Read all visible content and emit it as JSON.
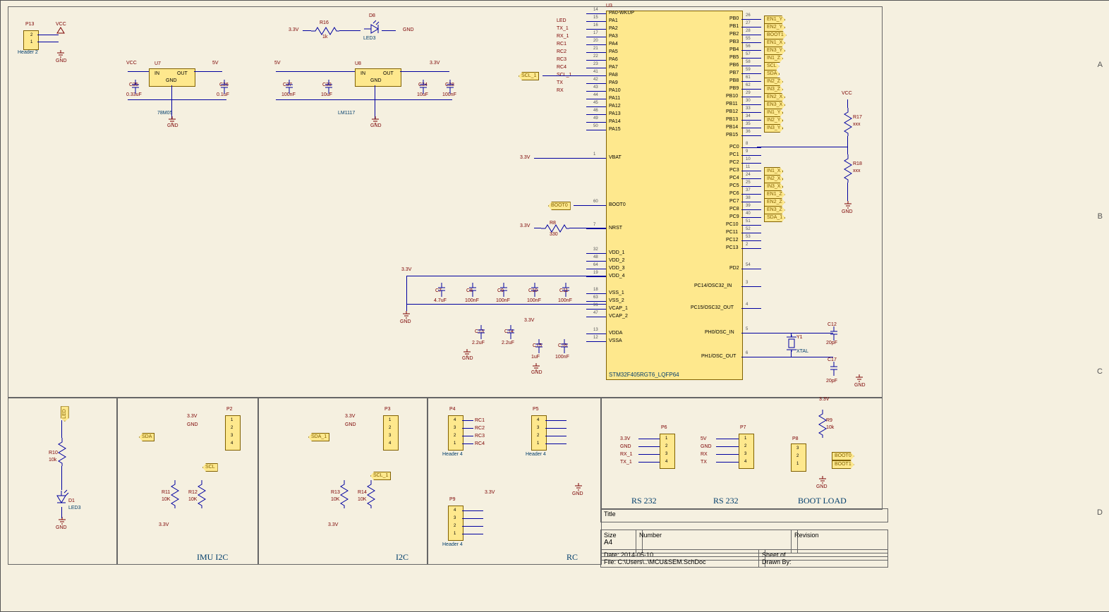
{
  "chart_data": {
    "type": "schematic",
    "title_block": {
      "title_label": "Title",
      "size_label": "Size",
      "size": "A4",
      "number_label": "Number",
      "revision_label": "Revision",
      "date_label": "Date:",
      "date": "2014-05-10",
      "sheet_label": "Sheet    of",
      "file_label": "File:",
      "file": "C:\\Users\\..\\MCU&SEM.SchDoc",
      "drawn_by_label": "Drawn By:"
    },
    "grid_rows": [
      "A",
      "B",
      "C",
      "D"
    ],
    "mcu": {
      "ref": "U3",
      "part": "STM32F405RGT6_LQFP64",
      "left_pins": [
        {
          "num": "14",
          "name": "PA0-WKUP",
          "net": ""
        },
        {
          "num": "15",
          "name": "PA1",
          "net": "LED"
        },
        {
          "num": "16",
          "name": "PA2",
          "net": "TX_1"
        },
        {
          "num": "17",
          "name": "PA3",
          "net": "RX_1"
        },
        {
          "num": "20",
          "name": "PA4",
          "net": "RC1"
        },
        {
          "num": "21",
          "name": "PA5",
          "net": "RC2"
        },
        {
          "num": "22",
          "name": "PA6",
          "net": "RC3"
        },
        {
          "num": "23",
          "name": "PA7",
          "net": "RC4"
        },
        {
          "num": "41",
          "name": "PA8",
          "net": "SCL_1"
        },
        {
          "num": "42",
          "name": "PA9",
          "net": "TX"
        },
        {
          "num": "43",
          "name": "PA10",
          "net": "RX"
        },
        {
          "num": "44",
          "name": "PA11",
          "net": ""
        },
        {
          "num": "45",
          "name": "PA12",
          "net": ""
        },
        {
          "num": "46",
          "name": "PA13",
          "net": ""
        },
        {
          "num": "49",
          "name": "PA14",
          "net": ""
        },
        {
          "num": "50",
          "name": "PA15",
          "net": ""
        },
        {
          "num": "1",
          "name": "VBAT",
          "net": "3.3V"
        },
        {
          "num": "60",
          "name": "BOOT0",
          "net": "BOOT0"
        },
        {
          "num": "7",
          "name": "NRST",
          "net": ""
        },
        {
          "num": "32",
          "name": "VDD_1",
          "net": ""
        },
        {
          "num": "48",
          "name": "VDD_2",
          "net": ""
        },
        {
          "num": "64",
          "name": "VDD_3",
          "net": ""
        },
        {
          "num": "19",
          "name": "VDD_4",
          "net": ""
        },
        {
          "num": "18",
          "name": "VSS_1",
          "net": ""
        },
        {
          "num": "63",
          "name": "VSS_2",
          "net": ""
        },
        {
          "num": "31",
          "name": "VCAP_1",
          "net": ""
        },
        {
          "num": "47",
          "name": "VCAP_2",
          "net": ""
        },
        {
          "num": "13",
          "name": "VDDA",
          "net": ""
        },
        {
          "num": "12",
          "name": "VSSA",
          "net": ""
        }
      ],
      "right_pins": [
        {
          "num": "26",
          "name": "PB0",
          "net": "EN1_Y"
        },
        {
          "num": "27",
          "name": "PB1",
          "net": "EN2_Y"
        },
        {
          "num": "28",
          "name": "PB2",
          "net": "BOOT1"
        },
        {
          "num": "55",
          "name": "PB3",
          "net": "EN1_X"
        },
        {
          "num": "56",
          "name": "PB4",
          "net": "EN3_Y"
        },
        {
          "num": "57",
          "name": "PB5",
          "net": "IN1_Z"
        },
        {
          "num": "58",
          "name": "PB6",
          "net": "SCL"
        },
        {
          "num": "59",
          "name": "PB7",
          "net": "SDA"
        },
        {
          "num": "61",
          "name": "PB8",
          "net": "IN2_Z"
        },
        {
          "num": "62",
          "name": "PB9",
          "net": "IN3_Z"
        },
        {
          "num": "29",
          "name": "PB10",
          "net": "EN2_X"
        },
        {
          "num": "30",
          "name": "PB11",
          "net": "EN3_X"
        },
        {
          "num": "33",
          "name": "PB12",
          "net": "IN1_Y"
        },
        {
          "num": "34",
          "name": "PB13",
          "net": "IN2_Y"
        },
        {
          "num": "35",
          "name": "PB14",
          "net": "IN3_Y"
        },
        {
          "num": "36",
          "name": "PB15",
          "net": ""
        },
        {
          "num": "8",
          "name": "PC0",
          "net": ""
        },
        {
          "num": "9",
          "name": "PC1",
          "net": ""
        },
        {
          "num": "10",
          "name": "PC2",
          "net": ""
        },
        {
          "num": "11",
          "name": "PC3",
          "net": "IN1_X"
        },
        {
          "num": "24",
          "name": "PC4",
          "net": "IN2_X"
        },
        {
          "num": "25",
          "name": "PC5",
          "net": "IN3_X"
        },
        {
          "num": "37",
          "name": "PC6",
          "net": "EN1_Z"
        },
        {
          "num": "38",
          "name": "PC7",
          "net": "EN2_Z"
        },
        {
          "num": "39",
          "name": "PC8",
          "net": "EN3_Z"
        },
        {
          "num": "40",
          "name": "PC9",
          "net": "SDA_1"
        },
        {
          "num": "51",
          "name": "PC10",
          "net": ""
        },
        {
          "num": "52",
          "name": "PC11",
          "net": ""
        },
        {
          "num": "53",
          "name": "PC12",
          "net": ""
        },
        {
          "num": "2",
          "name": "PC13",
          "net": ""
        },
        {
          "num": "54",
          "name": "PD2",
          "net": ""
        },
        {
          "num": "3",
          "name": "PC14/OSC32_IN",
          "net": ""
        },
        {
          "num": "4",
          "name": "PC15/OSC32_OUT",
          "net": ""
        },
        {
          "num": "5",
          "name": "PH0/OSC_IN",
          "net": ""
        },
        {
          "num": "6",
          "name": "PH1/OSC_OUT",
          "net": ""
        }
      ]
    },
    "regulators": {
      "u7": {
        "ref": "U7",
        "in": "IN",
        "out": "OUT",
        "gnd": "GND",
        "part": "78M05",
        "vin": "VCC",
        "vout": "5V",
        "c_in": {
          "ref": "C35",
          "val": "0.33uF"
        },
        "c_out": {
          "ref": "C36",
          "val": "0.1uF"
        }
      },
      "u8": {
        "ref": "U8",
        "in": "IN",
        "out": "OUT",
        "gnd": "GND",
        "part": "LM1117",
        "vin": "5V",
        "vout": "3.3V",
        "c1": {
          "ref": "C37",
          "val": "100nF"
        },
        "c2": {
          "ref": "C33",
          "val": "10uF"
        },
        "c3": {
          "ref": "C34",
          "val": "10uF"
        },
        "c4": {
          "ref": "C38",
          "val": "100nF"
        }
      }
    },
    "header_p13": {
      "ref": "P13",
      "type": "Header 2",
      "pins": [
        "2",
        "1"
      ],
      "vcc": "VCC",
      "gnd": "GND"
    },
    "led_d8": {
      "ref": "D8",
      "type": "LED3",
      "r": {
        "ref": "R16",
        "val": "1k"
      },
      "v": "3.3V",
      "gnd": "GND"
    },
    "nrst": {
      "r": {
        "ref": "R8",
        "val": "330"
      },
      "v": "3.3V"
    },
    "decoupling": [
      {
        "ref": "C7",
        "val": "4.7uF"
      },
      {
        "ref": "C8",
        "val": "100nF"
      },
      {
        "ref": "C9",
        "val": "100nF"
      },
      {
        "ref": "C10",
        "val": "100nF"
      },
      {
        "ref": "C11",
        "val": "100nF"
      }
    ],
    "vcap": [
      {
        "ref": "C13",
        "val": "2.2uF"
      },
      {
        "ref": "C14",
        "val": "2.2uF"
      }
    ],
    "vdda": [
      {
        "ref": "C15",
        "val": "1uF"
      },
      {
        "ref": "C16",
        "val": "100nF"
      }
    ],
    "vdda_pwr": "3.3V",
    "vdda_gnd": "GND",
    "vdd_pwr": "3.3V",
    "vss_gnd": "GND",
    "vcap_gnd": "GND",
    "crystal": {
      "ref": "Y1",
      "val": "XTAL",
      "c1": {
        "ref": "C12",
        "val": "20pF"
      },
      "c2": {
        "ref": "C17",
        "val": "20pF"
      },
      "gnd": "GND"
    },
    "pullup": {
      "r17": {
        "ref": "R17",
        "val": "xxx"
      },
      "r18": {
        "ref": "R18",
        "val": "xxx"
      },
      "v": "VCC",
      "gnd": "GND"
    },
    "blocks": {
      "led_blk": {
        "net": "LED",
        "r": {
          "ref": "R10",
          "val": "10k"
        },
        "d": {
          "ref": "D1",
          "type": "LED3"
        },
        "gnd": "GND"
      },
      "imu_i2c": {
        "title": "IMU I2C",
        "hdr": {
          "ref": "P2",
          "pins": [
            "1",
            "2",
            "3",
            "4"
          ]
        },
        "sda": "SDA",
        "scl": "SCL",
        "v": "3.3V",
        "gnd": "GND",
        "r1": {
          "ref": "R11",
          "val": "10K"
        },
        "r2": {
          "ref": "R12",
          "val": "10K"
        }
      },
      "i2c": {
        "title": "I2C",
        "hdr": {
          "ref": "P3",
          "pins": [
            "1",
            "2",
            "3",
            "4"
          ]
        },
        "sda": "SDA_1",
        "scl": "SCL_1",
        "v": "3.3V",
        "gnd": "GND",
        "r1": {
          "ref": "R13",
          "val": "10K"
        },
        "r2": {
          "ref": "R14",
          "val": "10K"
        }
      },
      "rc": {
        "title": "RC",
        "p4": {
          "ref": "P4",
          "type": "Header 4",
          "pins": [
            "4",
            "3",
            "2",
            "1"
          ],
          "nets": [
            "RC1",
            "RC2",
            "RC3",
            "RC4"
          ]
        },
        "p5": {
          "ref": "P5",
          "type": "Header 4",
          "pins": [
            "4",
            "3",
            "2",
            "1"
          ]
        },
        "p9": {
          "ref": "P9",
          "type": "Header 4",
          "pins": [
            "4",
            "3",
            "2",
            "1"
          ]
        },
        "v": "3.3V",
        "gnd": "GND"
      },
      "rs232_1": {
        "title": "RS 232",
        "hdr": {
          "ref": "P6",
          "pins": [
            "1",
            "2",
            "3",
            "4"
          ]
        },
        "nets": [
          "3.3V",
          "GND",
          "RX_1",
          "TX_1"
        ]
      },
      "rs232_2": {
        "title": "RS 232",
        "hdr": {
          "ref": "P7",
          "pins": [
            "1",
            "2",
            "3",
            "4"
          ]
        },
        "nets": [
          "5V",
          "GND",
          "RX",
          "TX"
        ]
      },
      "boot": {
        "title": "BOOT LOAD",
        "hdr": {
          "ref": "P8",
          "pins": [
            "3",
            "2",
            "1"
          ]
        },
        "nets": [
          "BOOT0",
          "BOOT1"
        ],
        "r": {
          "ref": "R9",
          "val": "10k"
        },
        "v": "3.3V",
        "gnd": "GND"
      }
    }
  }
}
